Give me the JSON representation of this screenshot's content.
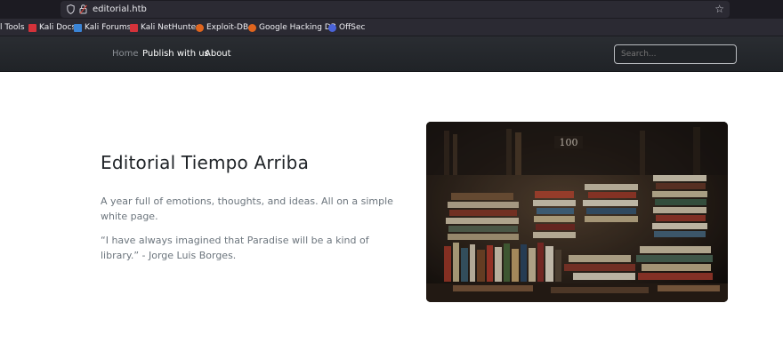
{
  "browser": {
    "url": "editorial.htb",
    "star_glyph": "☆"
  },
  "bookmarks": [
    {
      "label": "l Tools",
      "color": ""
    },
    {
      "label": "Kali Docs",
      "color": "#d4323a"
    },
    {
      "label": "Kali Forums",
      "color": "#3a84d6"
    },
    {
      "label": "Kali NetHunter",
      "color": "#d4323a"
    },
    {
      "label": "Exploit-DB",
      "color": "#e0651e"
    },
    {
      "label": "Google Hacking DB",
      "color": "#e0651e"
    },
    {
      "label": "OffSec",
      "color": "#4a63d8"
    }
  ],
  "nav": {
    "home": "Home",
    "publish": "Publish with us",
    "about": "About",
    "search_placeholder": "Search..."
  },
  "hero": {
    "title": "Editorial Tiempo Arriba",
    "paragraph1": "A year full of emotions, thoughts, and ideas. All on a simple white page.",
    "paragraph2": "“I have always imagined that Paradise will be a kind of library.” - Jorge Luis Borges."
  },
  "colors": {
    "navbar_bg": "#22252a",
    "browser_bg": "#2b2a33",
    "heading": "#212529",
    "muted_text": "#6c757d"
  }
}
